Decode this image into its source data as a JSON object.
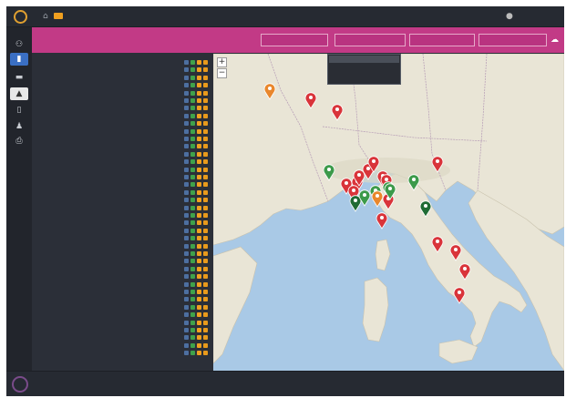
{
  "app": {
    "page_name": "",
    "user_name": "",
    "logout": ""
  },
  "header": {
    "title": "",
    "buttons": [
      "",
      "",
      ""
    ],
    "search_value": ""
  },
  "dropdown": {
    "options": [
      "",
      "",
      "",
      ""
    ],
    "selected_index": 0
  },
  "list": {
    "rows": [
      {
        "label": "",
        "sub": ""
      },
      {
        "label": "",
        "sub": ""
      },
      {
        "label": "",
        "sub": ""
      },
      {
        "label": "",
        "sub": ""
      },
      {
        "label": "",
        "sub": ""
      },
      {
        "label": "",
        "sub": ""
      },
      {
        "label": "",
        "sub": ""
      },
      {
        "label": "",
        "sub": ""
      },
      {
        "label": "",
        "sub": ""
      },
      {
        "label": "",
        "sub": ""
      },
      {
        "label": "",
        "sub": ""
      },
      {
        "label": "",
        "sub": ""
      },
      {
        "label": "",
        "sub": ""
      },
      {
        "label": "",
        "sub": ""
      },
      {
        "label": "",
        "sub": ""
      },
      {
        "label": "",
        "sub": ""
      },
      {
        "label": "",
        "sub": ""
      },
      {
        "label": "",
        "sub": ""
      },
      {
        "label": "",
        "sub": ""
      },
      {
        "label": "",
        "sub": ""
      },
      {
        "label": "",
        "sub": ""
      },
      {
        "label": "",
        "sub": ""
      },
      {
        "label": "",
        "sub": ""
      },
      {
        "label": "",
        "sub": ""
      },
      {
        "label": "",
        "sub": ""
      },
      {
        "label": "",
        "sub": ""
      },
      {
        "label": "",
        "sub": ""
      },
      {
        "label": "",
        "sub": ""
      },
      {
        "label": "",
        "sub": ""
      },
      {
        "label": "",
        "sub": ""
      },
      {
        "label": "",
        "sub": ""
      },
      {
        "label": "",
        "sub": ""
      },
      {
        "label": "",
        "sub": ""
      },
      {
        "label": "",
        "sub": ""
      },
      {
        "label": "",
        "sub": ""
      },
      {
        "label": "",
        "sub": ""
      },
      {
        "label": "",
        "sub": ""
      },
      {
        "label": "",
        "sub": ""
      },
      {
        "label": "",
        "sub": ""
      }
    ],
    "row_actions": [
      "map-pin-icon",
      "check-icon",
      "folder-icon",
      "edit-icon"
    ]
  },
  "map": {
    "zoom_in": "+",
    "zoom_out": "−",
    "marker_colors": {
      "red": "#d9343a",
      "green": "#3c9a4a",
      "dark_green": "#1f6b34",
      "orange": "#e9872c"
    },
    "markers": [
      {
        "color": "orange"
      },
      {
        "color": "red"
      },
      {
        "color": "red"
      },
      {
        "color": "green"
      },
      {
        "color": "red"
      },
      {
        "color": "red"
      },
      {
        "color": "red"
      },
      {
        "color": "red"
      },
      {
        "color": "red"
      },
      {
        "color": "red"
      },
      {
        "color": "red"
      },
      {
        "color": "green"
      },
      {
        "color": "green"
      },
      {
        "color": "red"
      },
      {
        "color": "red"
      },
      {
        "color": "green"
      },
      {
        "color": "orange"
      },
      {
        "color": "red"
      },
      {
        "color": "green"
      },
      {
        "color": "dark_green"
      },
      {
        "color": "green"
      },
      {
        "color": "red"
      },
      {
        "color": "dark_green"
      },
      {
        "color": "red"
      },
      {
        "color": "red"
      },
      {
        "color": "red"
      },
      {
        "color": "red"
      }
    ]
  },
  "footer": {
    "text": "",
    "version": ""
  },
  "colors": {
    "accent": "#c23a86",
    "app_bg": "#2b2f38",
    "topbar_bg": "#262a32",
    "rail_active": "#3a6fc4",
    "sea": "#a9c9e6",
    "land": "#eae6d9"
  },
  "icons": {
    "rail": [
      "users-icon",
      "list-icon",
      "card-icon",
      "upload-icon",
      "file-icon",
      "group-icon",
      "printer-icon"
    ],
    "topbar": [
      "home-icon",
      "folder-icon",
      "user-icon"
    ],
    "header": [
      "upload-icon"
    ]
  }
}
